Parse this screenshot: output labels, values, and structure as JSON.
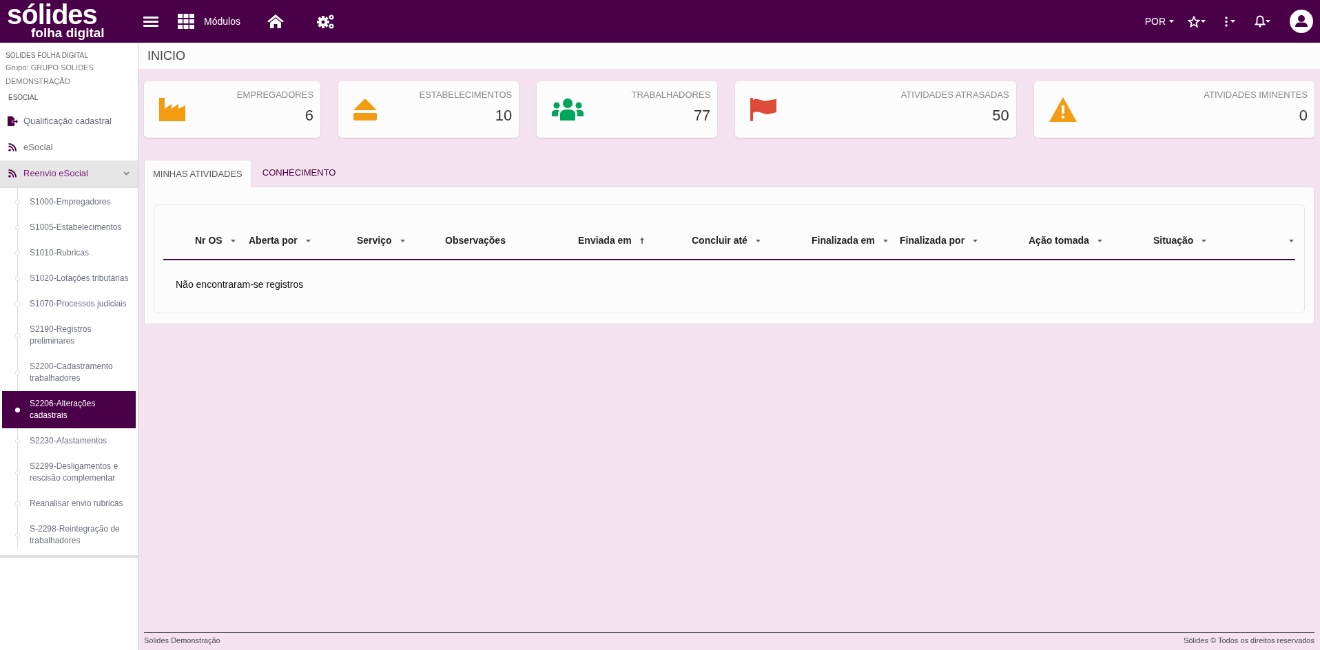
{
  "topbar": {
    "logo": "sólides",
    "logo_subtitle": "folha digital",
    "modules_label": "Módulos",
    "language": "POR"
  },
  "sidebar": {
    "company": "SOLIDES FOLHA DIGITAL",
    "group": "Grupo: GRUPO SOLIDES DEMONSTRAÇÃO",
    "section": "ESOCIAL",
    "items": [
      {
        "label": "Qualificação cadastral",
        "expanded": false
      },
      {
        "label": "eSocial",
        "expanded": false
      },
      {
        "label": "Reenvio eSocial",
        "expanded": true,
        "children": [
          {
            "label": "S1000-Empregadores",
            "selected": false
          },
          {
            "label": "S1005-Estabelecimentos",
            "selected": false
          },
          {
            "label": "S1010-Rubricas",
            "selected": false
          },
          {
            "label": "S1020-Lotações tributárias",
            "selected": false
          },
          {
            "label": "S1070-Processos judiciais",
            "selected": false
          },
          {
            "label": "S2190-Registros preliminares",
            "selected": false
          },
          {
            "label": "S2200-Cadastramento trabalhadores",
            "selected": false
          },
          {
            "label": "S2206-Alterações cadastrais",
            "selected": true
          },
          {
            "label": "S2230-Afastamentos",
            "selected": false
          },
          {
            "label": "S2299-Desligamentos e rescisão complementar",
            "selected": false
          },
          {
            "label": "Reanalisar envio rubricas",
            "selected": false
          },
          {
            "label": "S-2298-Reintegração de trabalhadores",
            "selected": false
          }
        ]
      }
    ]
  },
  "page_title": "INICIO",
  "cards": [
    {
      "label": "EMPREGADORES",
      "value": "6",
      "color": "#f39c12"
    },
    {
      "label": "ESTABELECIMENTOS",
      "value": "10",
      "color": "#f39c12"
    },
    {
      "label": "TRABALHADORES",
      "value": "77",
      "color": "#00a65a"
    },
    {
      "label": "ATIVIDADES ATRASADAS",
      "value": "50",
      "color": "#dd4b39"
    },
    {
      "label": "ATIVIDADES IMINENTES",
      "value": "0",
      "color": "#f39c12"
    }
  ],
  "tabs": [
    {
      "label": "MINHAS ATIVIDADES",
      "selected": true
    },
    {
      "label": "CONHECIMENTO",
      "selected": false
    }
  ],
  "table": {
    "columns": [
      {
        "label": "Nr OS",
        "kind": "menu"
      },
      {
        "label": "Aberta por",
        "kind": "menu"
      },
      {
        "label": "Serviço",
        "kind": "menu"
      },
      {
        "label": "Observações",
        "kind": "plain"
      },
      {
        "label": "Enviada em",
        "kind": "sorted"
      },
      {
        "label": "Concluir até",
        "kind": "menu"
      },
      {
        "label": "Finalizada em",
        "kind": "menu"
      },
      {
        "label": "Finalizada por",
        "kind": "menu"
      },
      {
        "label": "Ação tomada",
        "kind": "menu"
      },
      {
        "label": "Situação",
        "kind": "menu"
      },
      {
        "kind": "menu"
      }
    ],
    "empty_message": "Não encontraram-se registros"
  },
  "footer": {
    "left": "Solides Demonstração",
    "right": "Sólides © Todos os direitos reservados"
  }
}
